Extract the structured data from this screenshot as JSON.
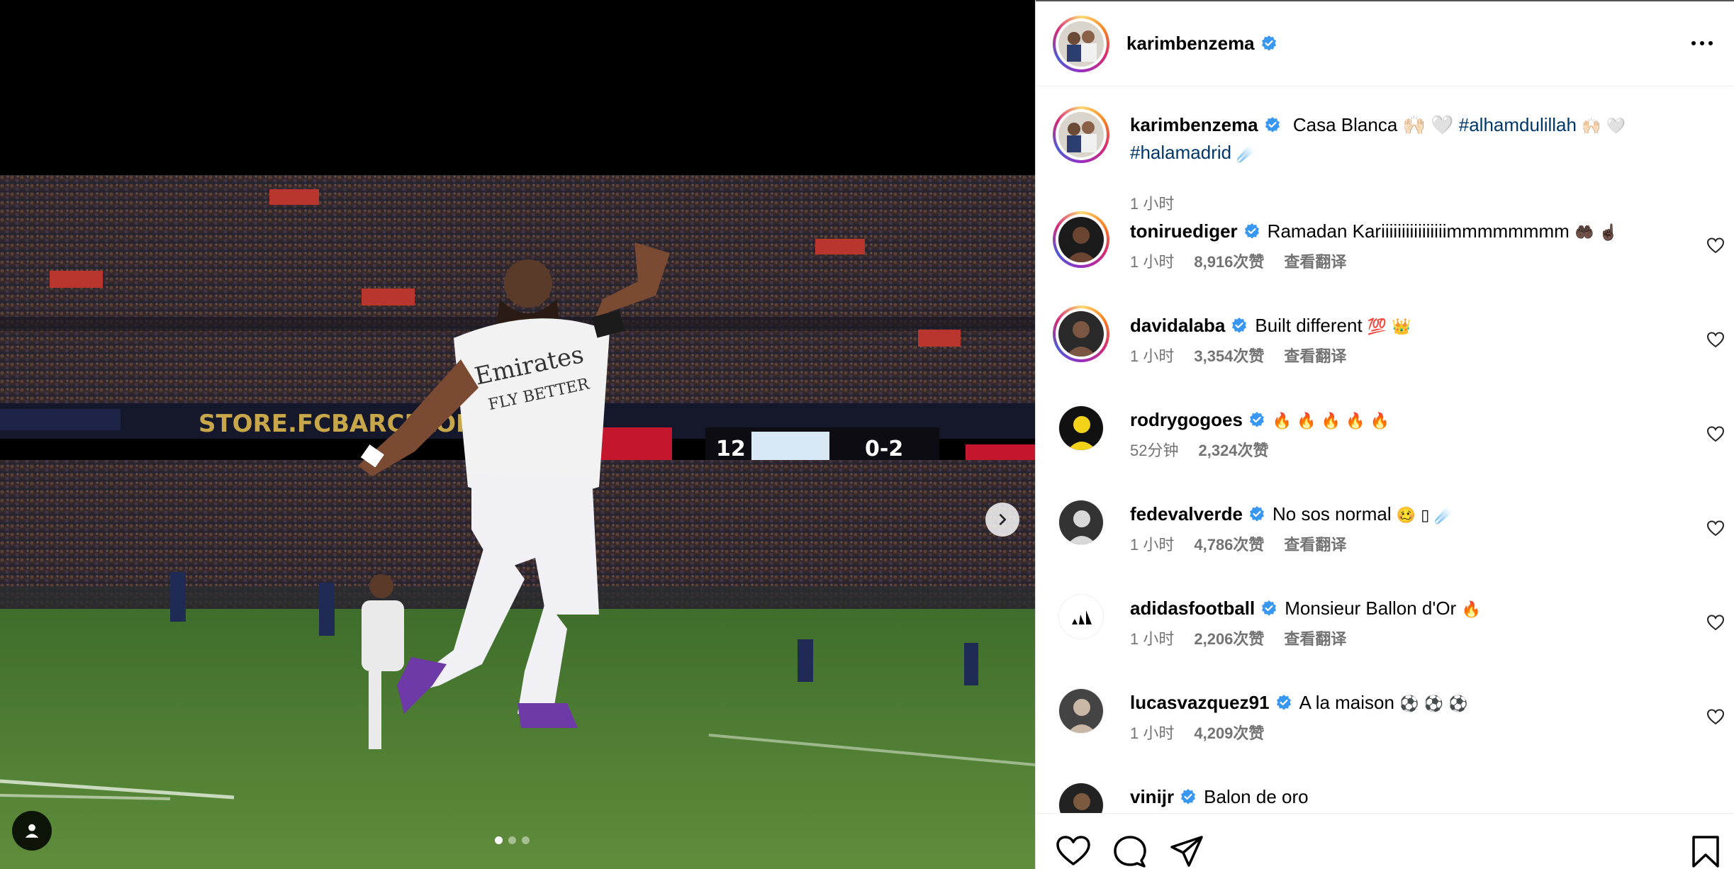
{
  "post": {
    "author": "karimbenzema",
    "caption_text": "Casa Blanca 🙌🏻 🤍",
    "caption_hashtag1": "#alhamdulillah",
    "caption_emoji1": "🙌🏻 🤍",
    "caption_hashtag2": "#halamadrid",
    "caption_emoji2": "☄️",
    "time": "1 小时"
  },
  "carousel": {
    "total": 3,
    "active": 1
  },
  "comments": [
    {
      "user": "toniruediger",
      "text": "Ramadan Kariiiiiiiiiiiiiiiimmmmmmmm",
      "emoji": "🤲🏿 ☝🏿",
      "time": "1 小时",
      "likes": "8,916次赞",
      "translate": "查看翻译"
    },
    {
      "user": "davidalaba",
      "text": "Built different",
      "emoji": "💯 👑",
      "time": "1 小时",
      "likes": "3,354次赞",
      "translate": "查看翻译"
    },
    {
      "user": "rodrygogoes",
      "text": "",
      "emoji": "🔥 🔥 🔥 🔥 🔥",
      "time": "52分钟",
      "likes": "2,324次赞",
      "translate": ""
    },
    {
      "user": "fedevalverde",
      "text": "No sos normal",
      "emoji": "🥴 ▯ ☄️",
      "time": "1 小时",
      "likes": "4,786次赞",
      "translate": "查看翻译"
    },
    {
      "user": "adidasfootball",
      "text": "Monsieur Ballon d'Or",
      "emoji": "🔥",
      "time": "1 小时",
      "likes": "2,206次赞",
      "translate": "查看翻译"
    },
    {
      "user": "lucasvazquez91",
      "text": "A la maison",
      "emoji": "⚽ ⚽ ⚽",
      "time": "1 小时",
      "likes": "4,209次赞",
      "translate": ""
    },
    {
      "user": "vinijr",
      "text": "Balon de oro",
      "emoji": "",
      "time": "",
      "likes": "",
      "translate": ""
    }
  ],
  "icons": {
    "verified": "verified-badge-icon",
    "like": "heart-icon",
    "comment": "comment-icon",
    "share": "share-icon",
    "save": "bookmark-icon",
    "more": "more-options-icon",
    "next": "chevron-right-icon",
    "tag": "user-tag-icon"
  },
  "colors": {
    "verified": "#3897f0",
    "hashtag": "#00376b",
    "meta": "#737373"
  }
}
